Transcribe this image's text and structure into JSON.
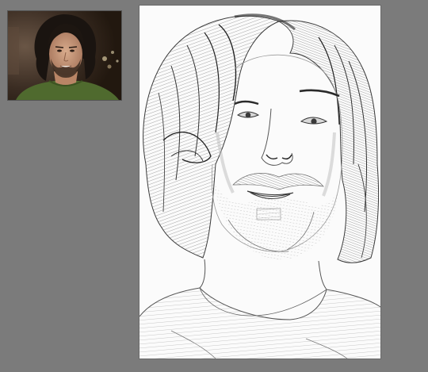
{
  "workspace": {
    "background_color": "#7b7b7b",
    "canvas_color": "#fbfbfb"
  },
  "reference_photo": {
    "icon": "reference-photo",
    "colors": {
      "background": "#3a2c22",
      "shirt": "#4f6a2e",
      "hair": "#1a1410",
      "skin": "#c89a7c"
    }
  },
  "sketch": {
    "icon": "pencil-portrait-sketch",
    "stroke_color": "#2a2a2a"
  }
}
